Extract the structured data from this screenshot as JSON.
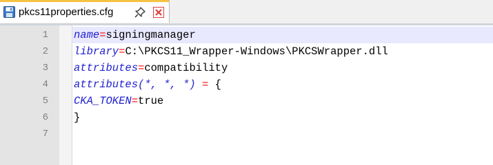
{
  "tab": {
    "filename": "pkcs11properties.cfg",
    "icons": [
      "save-icon",
      "pin-icon",
      "close-icon"
    ]
  },
  "editor": {
    "lines": [
      {
        "num": "1",
        "key": "name",
        "op": "=",
        "value": "signingmanager"
      },
      {
        "num": "2",
        "key": "library",
        "op": "=",
        "value": "C:\\PKCS11_Wrapper-Windows\\PKCSWrapper.dll"
      },
      {
        "num": "3",
        "key": "attributes",
        "op": "=",
        "value": "compatibility"
      },
      {
        "num": "4",
        "key": "attributes(*, *, *)",
        "op": " = ",
        "value": "{"
      },
      {
        "num": "5",
        "key": "CKA_TOKEN",
        "op": "=",
        "value": "true"
      },
      {
        "num": "6",
        "key": "",
        "op": "",
        "value": "}"
      },
      {
        "num": "7",
        "key": "",
        "op": "",
        "value": ""
      }
    ]
  },
  "colors": {
    "key": "#1f1fcf",
    "operator": "#ff0000",
    "current_line": "#e8e8ff",
    "tab_accent": "#f6c244",
    "close_icon": "#e03c3c"
  }
}
